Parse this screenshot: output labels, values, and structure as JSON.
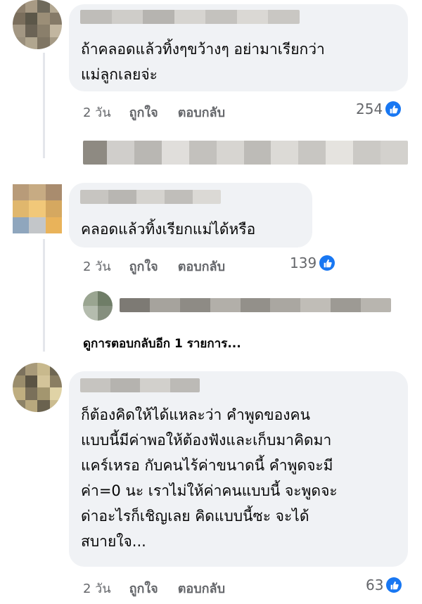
{
  "colors": {
    "like": "#1877f2",
    "bubble": "#f0f2f5",
    "meta": "#65676b"
  },
  "comments": [
    {
      "text": "ถ้าคลอดแล้วทิ้งๆขว้างๆ อย่ามาเรียกว่า\nแม่ลูกเลยจ่ะ",
      "time": "2 วัน",
      "like_label": "ถูกใจ",
      "reply_label": "ตอบกลับ",
      "reactions": "254",
      "reaction_icon": "like-icon"
    },
    {
      "text": "คลอดแล้วทิ้งเรียกแม่ได้หรือ",
      "time": "2 วัน",
      "like_label": "ถูกใจ",
      "reply_label": "ตอบกลับ",
      "reactions": "139",
      "reaction_icon": "like-icon"
    },
    {
      "text": "ก็ต้องคิดให้ได้แหละว่า  คำพูดของคน\nแบบนี้มีค่าพอให้ต้องฟังและเก็บมาคิดมา\nแคร์เหรอ  กับคนไร้ค่าขนาดนี้  คำพูดจะมี\nค่า=0 นะ เราไม่ให้ค่าคนแบบนี้  จะพูดจะ\nด่าอะไรก็เชิญเลย  คิดแบบนี้ซะ  จะได้\nสบายใจ...",
      "time": "2 วัน",
      "like_label": "ถูกใจ",
      "reply_label": "ตอบกลับ",
      "reactions": "63",
      "reaction_icon": "like-icon"
    }
  ],
  "view_more_replies": "ดูการตอบกลับอีก 1 รายการ..."
}
